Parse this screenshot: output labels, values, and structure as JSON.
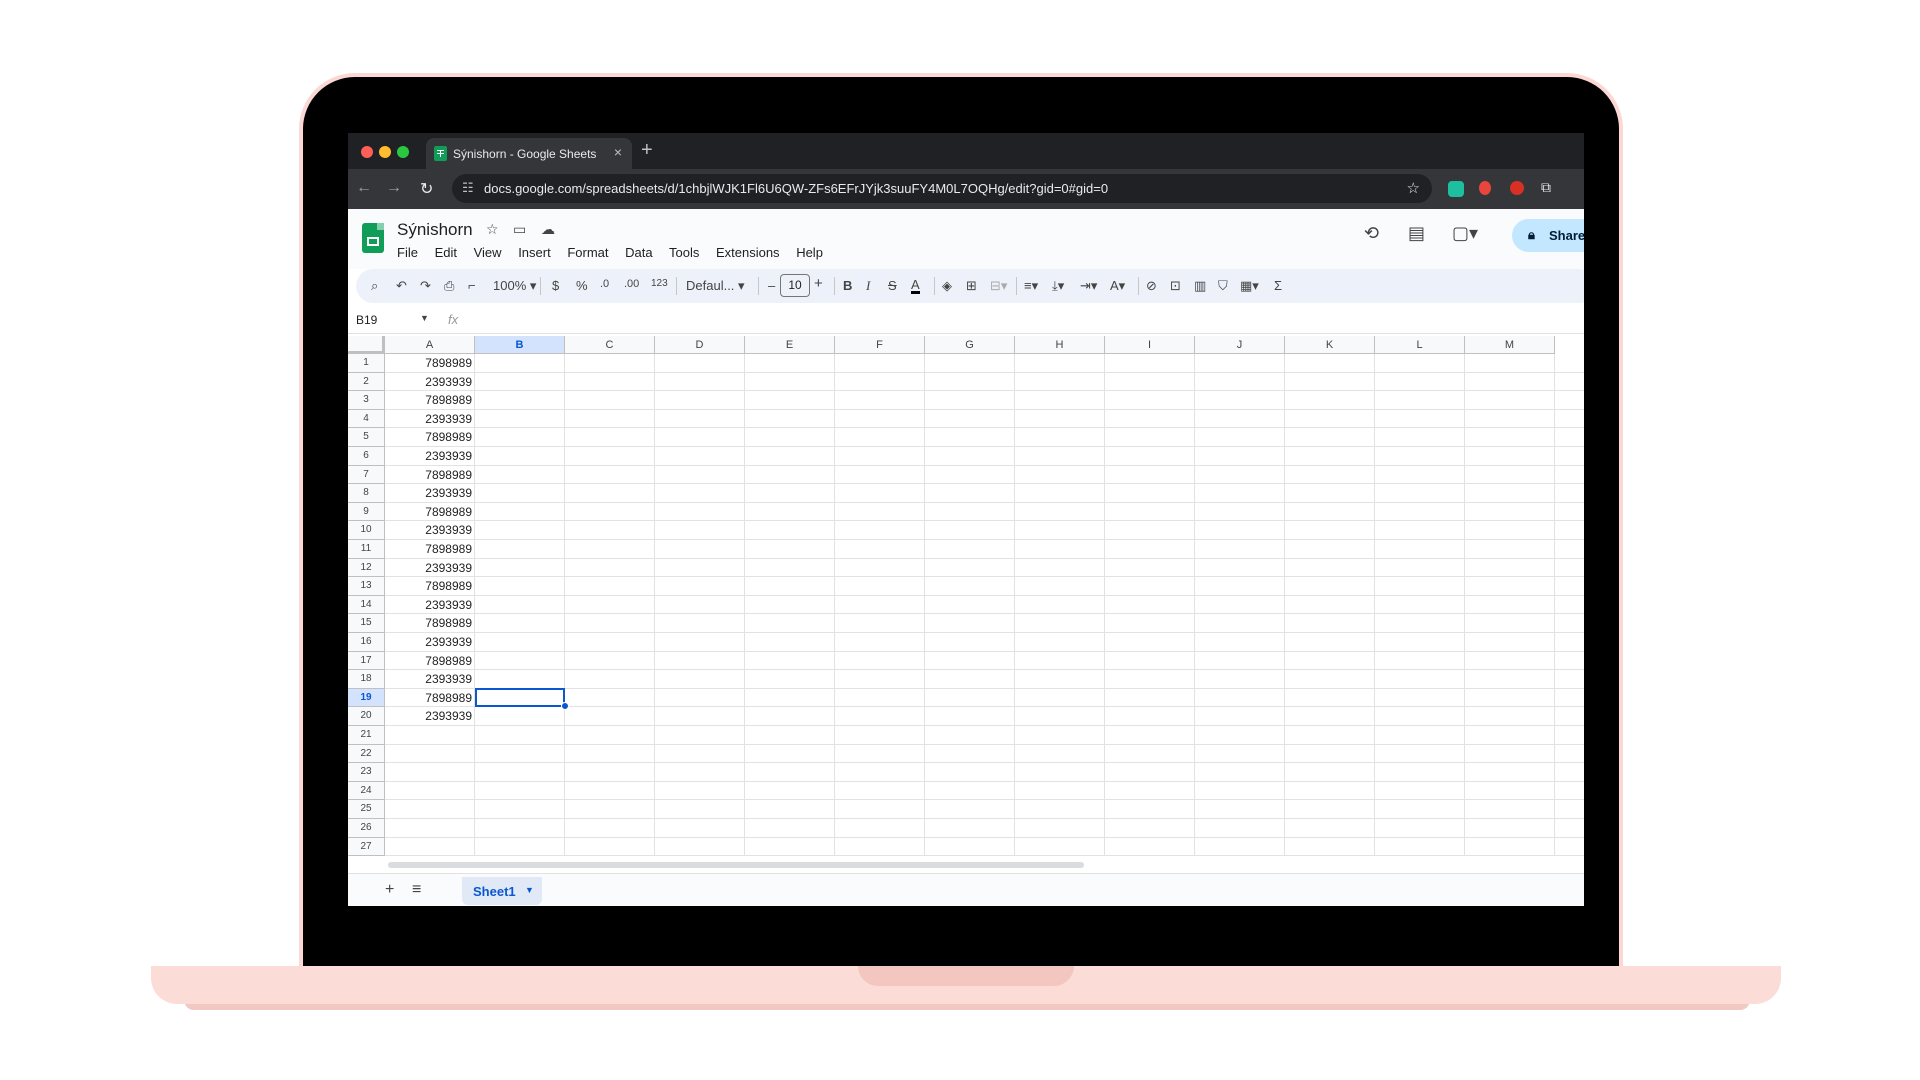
{
  "browser": {
    "tab_title": "Sýnishorn - Google Sheets",
    "close_glyph": "×",
    "new_tab_glyph": "+",
    "url": "docs.google.com/spreadsheets/d/1chbjlWJK1Fl6U6QW-ZFs6EFrJYjk3suuFY4M0L7OQHg/edit?gid=0#gid=0",
    "back_glyph": "←",
    "forward_glyph": "→",
    "reload_glyph": "↻",
    "bookmark_glyph": "☆"
  },
  "document": {
    "title": "Sýnishorn"
  },
  "menu": [
    "File",
    "Edit",
    "View",
    "Insert",
    "Format",
    "Data",
    "Tools",
    "Extensions",
    "Help"
  ],
  "share": {
    "label": "Share"
  },
  "toolbar": {
    "zoom": "100%",
    "currency": "$",
    "percent": "%",
    "decrease_decimal": ".0",
    "increase_decimal": ".00",
    "number_format": "123",
    "font": "Defaul...",
    "font_size": "10",
    "minus": "–",
    "plus": "+",
    "bold": "B",
    "italic": "I",
    "strikethrough": "S",
    "text_color": "A",
    "sum": "Σ"
  },
  "formula_bar": {
    "name_box": "B19",
    "fx": "fx"
  },
  "grid": {
    "columns": [
      "A",
      "B",
      "C",
      "D",
      "E",
      "F",
      "G",
      "H",
      "I",
      "J",
      "K",
      "L",
      "M"
    ],
    "selected_column": "B",
    "selected_row": "19",
    "rows": [
      "1",
      "2",
      "3",
      "4",
      "5",
      "6",
      "7",
      "8",
      "9",
      "10",
      "11",
      "12",
      "13",
      "14",
      "15",
      "16",
      "17",
      "18",
      "19",
      "20",
      "21",
      "22",
      "23",
      "24",
      "25",
      "26",
      "27"
    ],
    "column_a_values": [
      "7898989",
      "2393939",
      "7898989",
      "2393939",
      "7898989",
      "2393939",
      "7898989",
      "2393939",
      "7898989",
      "2393939",
      "7898989",
      "2393939",
      "7898989",
      "2393939",
      "7898989",
      "2393939",
      "7898989",
      "2393939",
      "7898989",
      "2393939"
    ]
  },
  "sheets": {
    "add_glyph": "+",
    "all_sheets_glyph": "≡",
    "active_sheet": "Sheet1"
  },
  "colors": {
    "accent": "#0b57d0",
    "selected_header": "#d3e3fd",
    "share_button": "#c2e7ff",
    "sheets_green": "#0f9d58",
    "laptop_body": "#fcdcd7"
  }
}
